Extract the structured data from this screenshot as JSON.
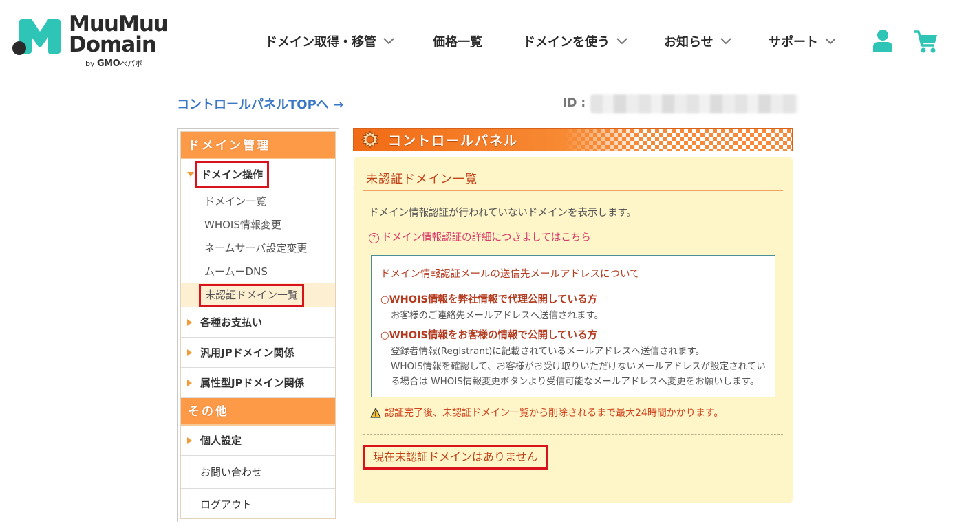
{
  "brand": {
    "line1": "MuuMuu",
    "line2": "Domain",
    "by": "by",
    "gmo": "GMO",
    "pepabo": "ペパボ",
    "accent": "#2ec4b6"
  },
  "nav": [
    {
      "label": "ドメイン取得・移管",
      "dropdown": true
    },
    {
      "label": "価格一覧",
      "dropdown": false
    },
    {
      "label": "ドメインを使う",
      "dropdown": true
    },
    {
      "label": "お知らせ",
      "dropdown": true
    },
    {
      "label": "サポート",
      "dropdown": true
    }
  ],
  "header_icons": [
    "user-icon",
    "cart-icon"
  ],
  "top_link": "コントロールパネルTOPへ →",
  "id_label": "ID :",
  "sidebar": {
    "section1": "ドメイン管理",
    "domain_ops": "ドメイン操作",
    "sub_items": [
      "ドメイン一覧",
      "WHOIS情報変更",
      "ネームサーバ設定変更",
      "ムームーDNS",
      "未認証ドメイン一覧"
    ],
    "payments": "各種お支払い",
    "jp": "汎用JPドメイン関係",
    "attr_jp": "属性型JPドメイン関係",
    "section2": "その他",
    "personal": "個人設定",
    "contact": "お問い合わせ",
    "logout": "ログアウト"
  },
  "panel": {
    "banner": "コントロールパネル",
    "title": "未認証ドメイン一覧",
    "description": "ドメイン情報認証が行われていないドメインを表示します。",
    "help_link": "ドメイン情報認証の詳細につきましてはこちら",
    "infobox": {
      "title": "ドメイン情報認証メールの送信先メールアドレスについて",
      "case1_head": "○WHOIS情報を弊社情報で代理公開している方",
      "case1_text": "お客様のご連絡先メールアドレスへ送信されます。",
      "case2_head": "○WHOIS情報をお客様の情報で公開している方",
      "case2_text1": "登録者情報(Registrant)に記載されているメールアドレスへ送信されます。",
      "case2_text2": "WHOIS情報を確認して、お客様がお受け取りいただけないメールアドレスが設定されてい",
      "case2_text3": "る場合は WHOIS情報変更ボタンより受信可能なメールアドレスへ変更をお願いします。"
    },
    "warning": "認証完了後、未認証ドメイン一覧から削除されるまで最大24時間かかります。",
    "empty_message": "現在未認証ドメインはありません"
  }
}
